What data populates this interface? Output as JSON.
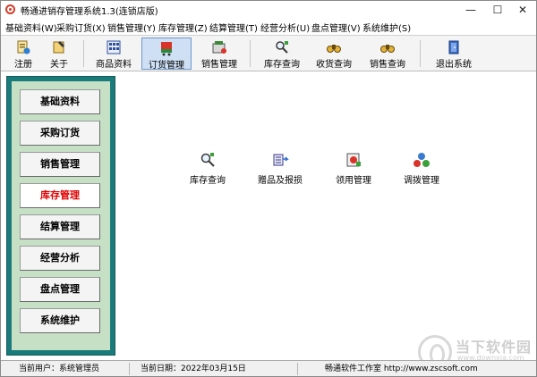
{
  "window": {
    "title": "畅通进销存管理系统1.3(连锁店版)",
    "controls": {
      "minimize": "—",
      "maximize": "☐",
      "close": "✕"
    }
  },
  "menu": [
    "基础资料(W)",
    "采购订货(X)",
    "销售管理(Y)",
    "库存管理(Z)",
    "结算管理(T)",
    "经营分析(U)",
    "盘点管理(V)",
    "系统维护(S)"
  ],
  "toolbar": {
    "register": "注册",
    "about": "关于",
    "goods": "商品资料",
    "order": "订货管理",
    "sales": "销售管理",
    "stock_query": "库存查询",
    "receive_query": "收货查询",
    "sales_query": "销售查询",
    "exit": "退出系统",
    "active": "order"
  },
  "sidebar": {
    "items": [
      "基础资料",
      "采购订货",
      "销售管理",
      "库存管理",
      "结算管理",
      "经营分析",
      "盘点管理",
      "系统维护"
    ],
    "active_index": 3,
    "panel_color": "#1b7b7b",
    "inner_color": "#c6e0c6",
    "active_text_color": "#e00000"
  },
  "functions": [
    {
      "label": "库存查询",
      "icon": "magnifier-stock-icon"
    },
    {
      "label": "赠品及报损",
      "icon": "gift-loss-icon"
    },
    {
      "label": "领用管理",
      "icon": "requisition-icon"
    },
    {
      "label": "调拨管理",
      "icon": "transfer-icon"
    }
  ],
  "status": {
    "user": "当前用户：系统管理员",
    "date": "当前日期：2022年03月15日",
    "company": "畅通软件工作室 http://www.zscsoft.com"
  },
  "watermark": {
    "title": "当下软件园",
    "url": "www.downxia.com"
  }
}
